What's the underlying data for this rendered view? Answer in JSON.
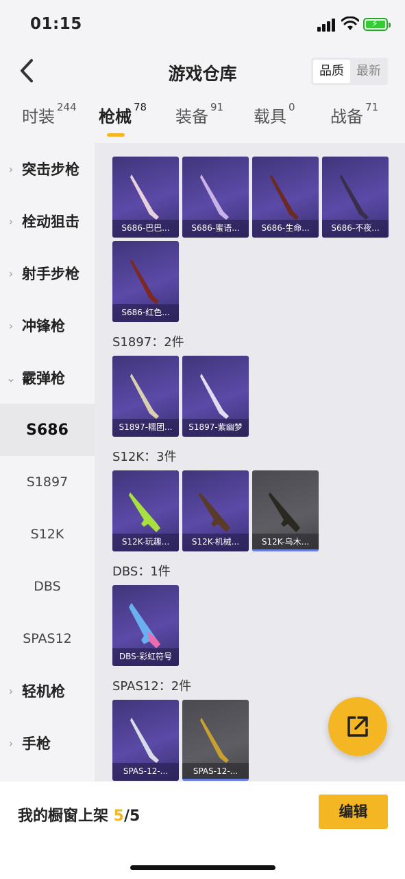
{
  "status_bar": {
    "time": "01:15"
  },
  "header": {
    "title": "游戏仓库",
    "sort_quality": "品质",
    "sort_newest": "最新"
  },
  "tabs": [
    {
      "label": "时装",
      "count": "244"
    },
    {
      "label": "枪械",
      "count": "78"
    },
    {
      "label": "装备",
      "count": "91"
    },
    {
      "label": "载具",
      "count": "0"
    },
    {
      "label": "战备",
      "count": "71"
    }
  ],
  "sidebar": {
    "categories": [
      "突击步枪",
      "栓动狙击",
      "射手步枪",
      "冲锋枪",
      "霰弹枪"
    ],
    "subs": [
      "S686",
      "S1897",
      "S12K",
      "DBS",
      "SPAS12"
    ],
    "more": [
      "轻机枪",
      "手枪"
    ]
  },
  "content": {
    "partial_header": "",
    "s686_items": [
      "S686-巴巴...",
      "S686-蜜语...",
      "S686-生命...",
      "S686-不夜...",
      "S686-红色..."
    ],
    "s1897_header": "S1897：2件",
    "s1897_items": [
      "S1897-糯团...",
      "S1897-紫幽梦"
    ],
    "s12k_header": "S12K：3件",
    "s12k_items": [
      "S12K-玩趣...",
      "S12K-机械...",
      "S12K-乌木..."
    ],
    "dbs_header": "DBS：1件",
    "dbs_items": [
      "DBS-彩虹符号"
    ],
    "spas_header": "SPAS12：2件",
    "spas_items": [
      "SPAS-12-...",
      "SPAS-12-..."
    ]
  },
  "bottom": {
    "label": "我的橱窗上架 ",
    "current": "5",
    "sep_total": "/5",
    "edit": "编辑"
  },
  "colors": {
    "accent": "#f5b624",
    "purple_card": "#4b3d8f",
    "grey_card": "#55555b"
  }
}
